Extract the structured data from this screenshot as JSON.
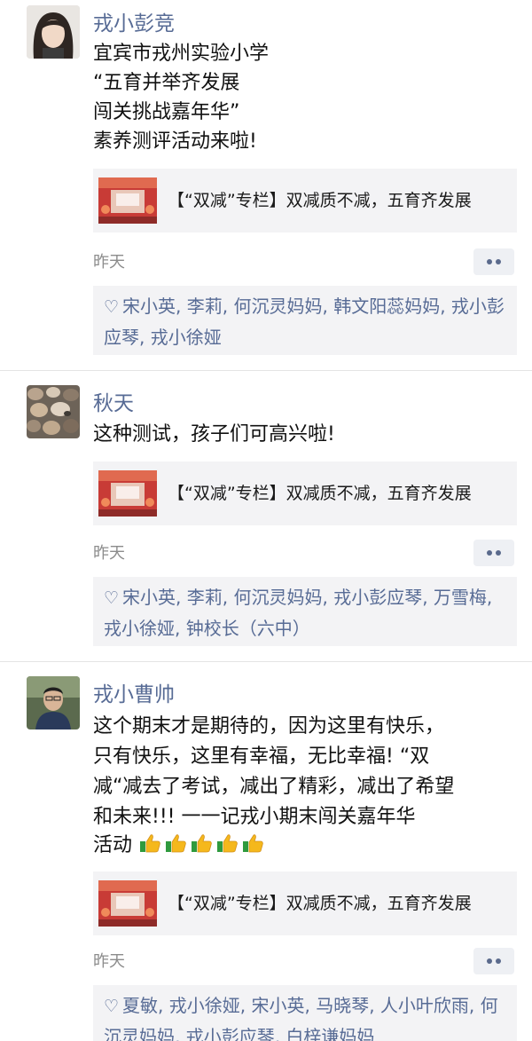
{
  "posts": [
    {
      "author": "戎小彭竞",
      "lines": [
        "宜宾市戎州实验小学",
        "“五育并举齐发展",
        "闯关挑战嘉年华”",
        "素养测评活动来啦!"
      ],
      "card_title": "【“双减”专栏】双减质不减，五育齐发展",
      "time": "昨天",
      "likes": "宋小英, 李莉, 何沉灵妈妈, 韩文阳蕊妈妈, 戎小彭应琴, 戎小徐娅"
    },
    {
      "author": "秋天",
      "lines": [
        "这种测试，孩子们可高兴啦!"
      ],
      "card_title": "【“双减”专栏】双减质不减，五育齐发展",
      "time": "昨天",
      "likes": "宋小英, 李莉, 何沉灵妈妈, 戎小彭应琴, 万雪梅, 戎小徐娅, 钟校长（六中）"
    },
    {
      "author": "戎小曹帅",
      "lines": [
        "这个期末才是期待的，因为这里有快乐，",
        "只有快乐，这里有幸福，无比幸福! “双",
        "减“减去了考试，减出了精彩，减出了希望",
        "和未来!!! 一一记戎小期末闯关嘉年华",
        "活动"
      ],
      "card_title": "【“双减”专栏】双减质不减，五育齐发展",
      "time": "昨天",
      "likes": "夏敏, 戎小徐娅, 宋小英, 马晓琴, 人小叶欣雨, 何沉灵妈妈, 戎小彭应琴, 白梓谦妈妈"
    }
  ],
  "icons": {
    "heart": "♡",
    "more": "more-dots-icon",
    "thumbs_up": "thumbs-up-icon"
  },
  "colors": {
    "name": "#576b95",
    "card_bg": "#f3f3f5",
    "divider": "#e4e4e4"
  }
}
